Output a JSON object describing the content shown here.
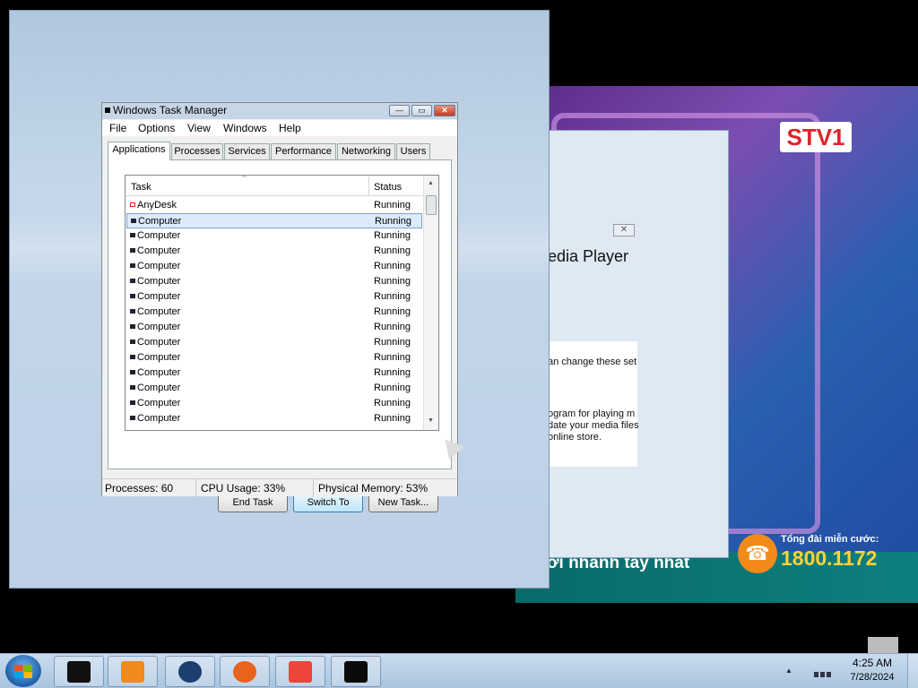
{
  "background_video": {
    "channel_logo": "STV1",
    "ticker_text": "ới nhanh tay nhất",
    "hotline_label": "Tổng đài miễn cước:",
    "hotline_number": "1800.1172"
  },
  "wmp_dialog": {
    "title_fragment": "edia Player",
    "close_label": "✕",
    "line1": "an change these set",
    "line2": "ogram for playing m",
    "line3": "date your media files",
    "line4": "online store."
  },
  "task_manager": {
    "title": "Windows Task Manager",
    "caption_buttons": {
      "minimize": "—",
      "maximize": "▭",
      "close": "✕"
    },
    "menu": [
      "File",
      "Options",
      "View",
      "Windows",
      "Help"
    ],
    "tabs": [
      "Applications",
      "Processes",
      "Services",
      "Performance",
      "Networking",
      "Users"
    ],
    "active_tab": "Applications",
    "columns": {
      "task": "Task",
      "status": "Status"
    },
    "sort_indicator": "^",
    "rows": [
      {
        "task": "AnyDesk",
        "status": "Running"
      },
      {
        "task": "Computer",
        "status": "Running"
      },
      {
        "task": "Computer",
        "status": "Running"
      },
      {
        "task": "Computer",
        "status": "Running"
      },
      {
        "task": "Computer",
        "status": "Running"
      },
      {
        "task": "Computer",
        "status": "Running"
      },
      {
        "task": "Computer",
        "status": "Running"
      },
      {
        "task": "Computer",
        "status": "Running"
      },
      {
        "task": "Computer",
        "status": "Running"
      },
      {
        "task": "Computer",
        "status": "Running"
      },
      {
        "task": "Computer",
        "status": "Running"
      },
      {
        "task": "Computer",
        "status": "Running"
      },
      {
        "task": "Computer",
        "status": "Running"
      },
      {
        "task": "Computer",
        "status": "Running"
      },
      {
        "task": "Computer",
        "status": "Running"
      }
    ],
    "selected_row": 1,
    "scroll": {
      "up": "▲",
      "down": "▼"
    },
    "buttons": {
      "end_task": "End Task",
      "switch_to": "Switch To",
      "new_task": "New Task..."
    },
    "status_bar": {
      "processes": "Processes: 60",
      "cpu": "CPU Usage: 33%",
      "memory": "Physical Memory: 53%"
    }
  },
  "taskbar": {
    "apps": [
      {
        "name": "media-device-icon",
        "color": "#111111"
      },
      {
        "name": "media-player-icon",
        "color": "#f08a1c"
      },
      {
        "name": "globe-icon",
        "color": "#1c3f70"
      },
      {
        "name": "firefox-icon",
        "color": "#e8631c"
      },
      {
        "name": "anydesk-icon",
        "color": "#ef443b"
      },
      {
        "name": "resource-monitor-icon",
        "color": "#0b0b0b"
      }
    ],
    "tray_arrow": "▲",
    "clock_time": "4:25 AM",
    "clock_date": "7/28/2024"
  }
}
